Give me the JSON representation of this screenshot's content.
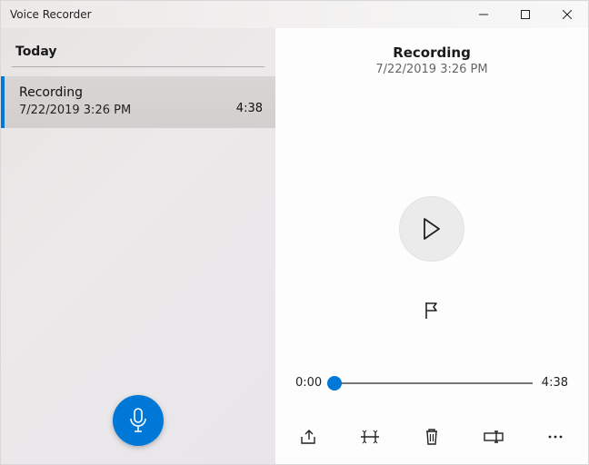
{
  "window": {
    "title": "Voice Recorder"
  },
  "colors": {
    "accent": "#0078d7"
  },
  "sidebar": {
    "section_label": "Today",
    "recordings": [
      {
        "title": "Recording",
        "date": "7/22/2019 3:26 PM",
        "duration": "4:38"
      }
    ]
  },
  "main": {
    "title": "Recording",
    "date": "7/22/2019 3:26 PM",
    "playback": {
      "current_time": "0:00",
      "total_time": "4:38"
    }
  },
  "icons": {
    "minimize": "minimize-icon",
    "maximize": "maximize-icon",
    "close": "close-icon",
    "microphone": "microphone-icon",
    "play": "play-icon",
    "flag": "flag-icon",
    "share": "share-icon",
    "trim": "trim-icon",
    "delete": "delete-icon",
    "rename": "rename-icon",
    "more": "more-icon"
  }
}
